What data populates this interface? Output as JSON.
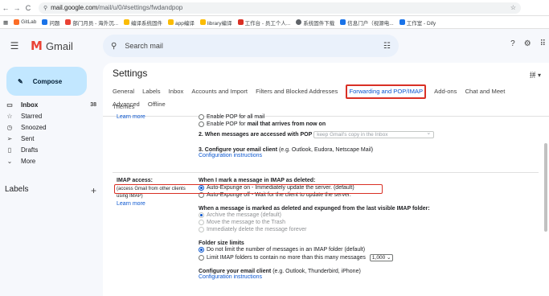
{
  "browser": {
    "back": "←",
    "forward": "→",
    "reload": "C",
    "url_host": "mail.google.com",
    "url_path": "/mail/u/0/#settings/fwdandpop",
    "bookmarks": [
      "GitLab",
      "问题",
      "部门月员 - 海外沉...",
      "编译系统固件",
      "app编译",
      "library编译",
      "工作台 - 员工个人...",
      "系统固件下载",
      "信息门户（视源电...",
      "工作室 - Dify"
    ]
  },
  "topbar": {
    "app_name": "Gmail",
    "search_placeholder": "Search mail"
  },
  "sidebar": {
    "compose": "Compose",
    "items": [
      {
        "label": "Inbox",
        "count": "38",
        "icon": "inbox-icon",
        "glyph": "▭"
      },
      {
        "label": "Starred",
        "count": "",
        "icon": "star-icon",
        "glyph": "☆"
      },
      {
        "label": "Snoozed",
        "count": "",
        "icon": "clock-icon",
        "glyph": "◷"
      },
      {
        "label": "Sent",
        "count": "",
        "icon": "send-icon",
        "glyph": "➢"
      },
      {
        "label": "Drafts",
        "count": "",
        "icon": "draft-icon",
        "glyph": "▯"
      },
      {
        "label": "More",
        "count": "",
        "icon": "chevron-down-icon",
        "glyph": "⌄"
      }
    ],
    "labels_title": "Labels",
    "labels_add": "+"
  },
  "settings": {
    "title": "Settings",
    "lang": "拼 ▾",
    "tabs": [
      "General",
      "Labels",
      "Inbox",
      "Accounts and Import",
      "Filters and Blocked Addresses",
      "Forwarding and POP/IMAP",
      "Add-ons",
      "Chat and Meet",
      "Advanced",
      "Offline"
    ],
    "active_tab": "Forwarding and POP/IMAP",
    "tab_row2": "Themes"
  },
  "pop": {
    "learn_more": "Learn more",
    "opt_all_mail": "Enable POP for all mail",
    "opt_from_now_prefix": "Enable POP for ",
    "opt_from_now_bold": "mail that arrives from now on",
    "when_accessed_label": "2. When messages are accessed with POP",
    "when_accessed_value": "keep Gmail's copy in the Inbox",
    "configure_bold": "3. Configure your email client",
    "configure_rest": " (e.g. Outlook, Eudora, Netscape Mail)",
    "config_link": "Configuration instructions"
  },
  "imap": {
    "label": "IMAP access:",
    "label_sub": "(access Gmail from other clients using IMAP)",
    "learn_more": "Learn more",
    "deleted_header": "When I mark a message in IMAP as deleted:",
    "expunge_on": "Auto-Expunge on - Immediately update the server. (default)",
    "expunge_off": "Auto-Expunge off - Wait for the client to update the server.",
    "expunged_header": "When a message is marked as deleted and expunged from the last visible IMAP folder:",
    "expunged_opts": [
      "Archive the message (default)",
      "Move the message to the Trash",
      "Immediately delete the message forever"
    ],
    "folder_header": "Folder size limits",
    "folder_opt1": "Do not limit the number of messages in an IMAP folder (default)",
    "folder_opt2": "Limit IMAP folders to contain no more than this many messages",
    "folder_limit_value": "1,000",
    "client_bold": "Configure your email client",
    "client_rest": " (e.g. Outlook, Thunderbird, iPhone)",
    "client_link": "Configuration instructions"
  },
  "colors": {
    "accent": "#0b57d0",
    "highlight": "#d93025",
    "compose_bg": "#c2e7ff"
  }
}
